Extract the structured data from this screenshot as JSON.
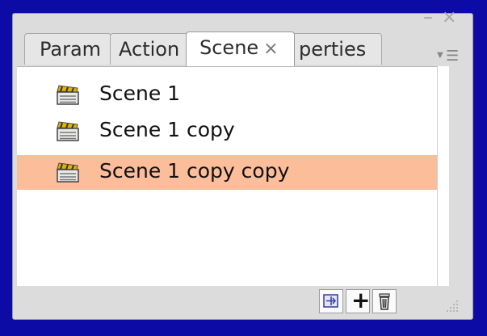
{
  "window": {
    "minimize_glyph": "–",
    "close_glyph": "×"
  },
  "tabs": [
    {
      "label": "Param"
    },
    {
      "label": "Action"
    },
    {
      "label": "Scene",
      "close": "×"
    },
    {
      "label": "perties"
    }
  ],
  "panel_menu": {
    "arrow": "▼",
    "lines": "☰"
  },
  "scenes": [
    {
      "label": "Scene 1",
      "icon": "clapperboard-icon",
      "selected": false
    },
    {
      "label": "Scene 1 copy",
      "icon": "clapperboard-icon",
      "selected": false
    },
    {
      "label": "Scene 1 copy copy",
      "icon": "clapperboard-icon",
      "selected": true
    }
  ],
  "footer": {
    "add_glyph": "+",
    "buttons": [
      "duplicate-scene",
      "add-scene",
      "delete-scene"
    ]
  },
  "colors": {
    "background": "#0d0ba6",
    "selection": "#fcbd9b",
    "panel": "#dcdcdc"
  }
}
